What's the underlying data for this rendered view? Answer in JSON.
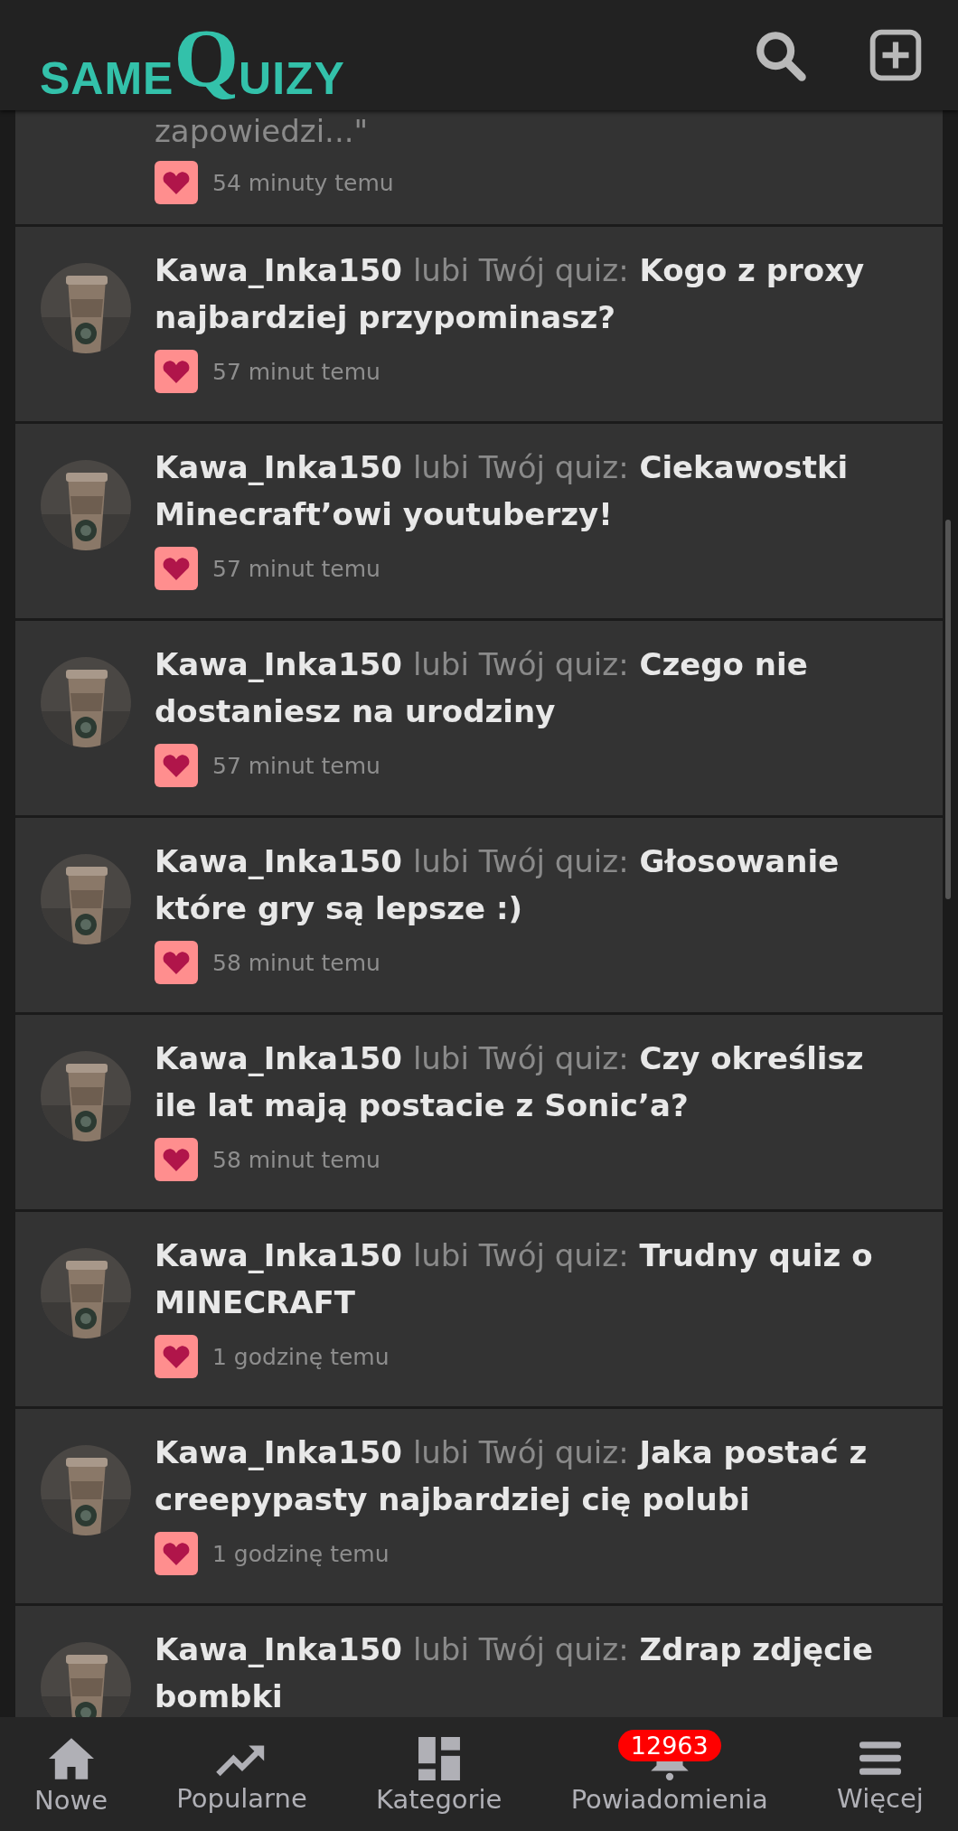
{
  "header": {
    "logo_small": "SAME",
    "logo_big": "Q",
    "logo_rest": "UIZY"
  },
  "notifications": [
    {
      "kind": "comment",
      "text": "zapowiedzi...\"",
      "time": "54 minuty temu"
    },
    {
      "kind": "like",
      "user": "Kawa_Inka150",
      "action": "lubi Twój quiz:",
      "quiz": "Kogo z proxy najbardziej przypominasz?",
      "time": "57 minut temu"
    },
    {
      "kind": "like",
      "user": "Kawa_Inka150",
      "action": "lubi Twój quiz:",
      "quiz": "Ciekawostki Minecraft’owi youtuberzy!",
      "time": "57 minut temu"
    },
    {
      "kind": "like",
      "user": "Kawa_Inka150",
      "action": "lubi Twój quiz:",
      "quiz": "Czego nie dostaniesz na urodziny",
      "time": "57 minut temu"
    },
    {
      "kind": "like",
      "user": "Kawa_Inka150",
      "action": "lubi Twój quiz:",
      "quiz": "Głosowanie które gry są lepsze :)",
      "time": "58 minut temu"
    },
    {
      "kind": "like",
      "user": "Kawa_Inka150",
      "action": "lubi Twój quiz:",
      "quiz": "Czy określisz ile lat mają postacie z Sonic’a?",
      "time": "58 minut temu"
    },
    {
      "kind": "like",
      "user": "Kawa_Inka150",
      "action": "lubi Twój quiz:",
      "quiz": "Trudny quiz o MINECRAFT",
      "time": "1 godzinę temu"
    },
    {
      "kind": "like",
      "user": "Kawa_Inka150",
      "action": "lubi Twój quiz:",
      "quiz": "Jaka postać z creepypasty najbardziej cię polubi",
      "time": "1 godzinę temu"
    },
    {
      "kind": "like",
      "user": "Kawa_Inka150",
      "action": "lubi Twój quiz:",
      "quiz": "Zdrap zdjęcie bombki"
    }
  ],
  "bottom_nav": [
    {
      "kind": "home",
      "label": "Nowe"
    },
    {
      "kind": "trend",
      "label": "Popularne"
    },
    {
      "kind": "grid",
      "label": "Kategorie"
    },
    {
      "kind": "bell",
      "label": "Powiadomienia",
      "badge": "12963"
    },
    {
      "kind": "menu",
      "label": "Więcej"
    }
  ]
}
